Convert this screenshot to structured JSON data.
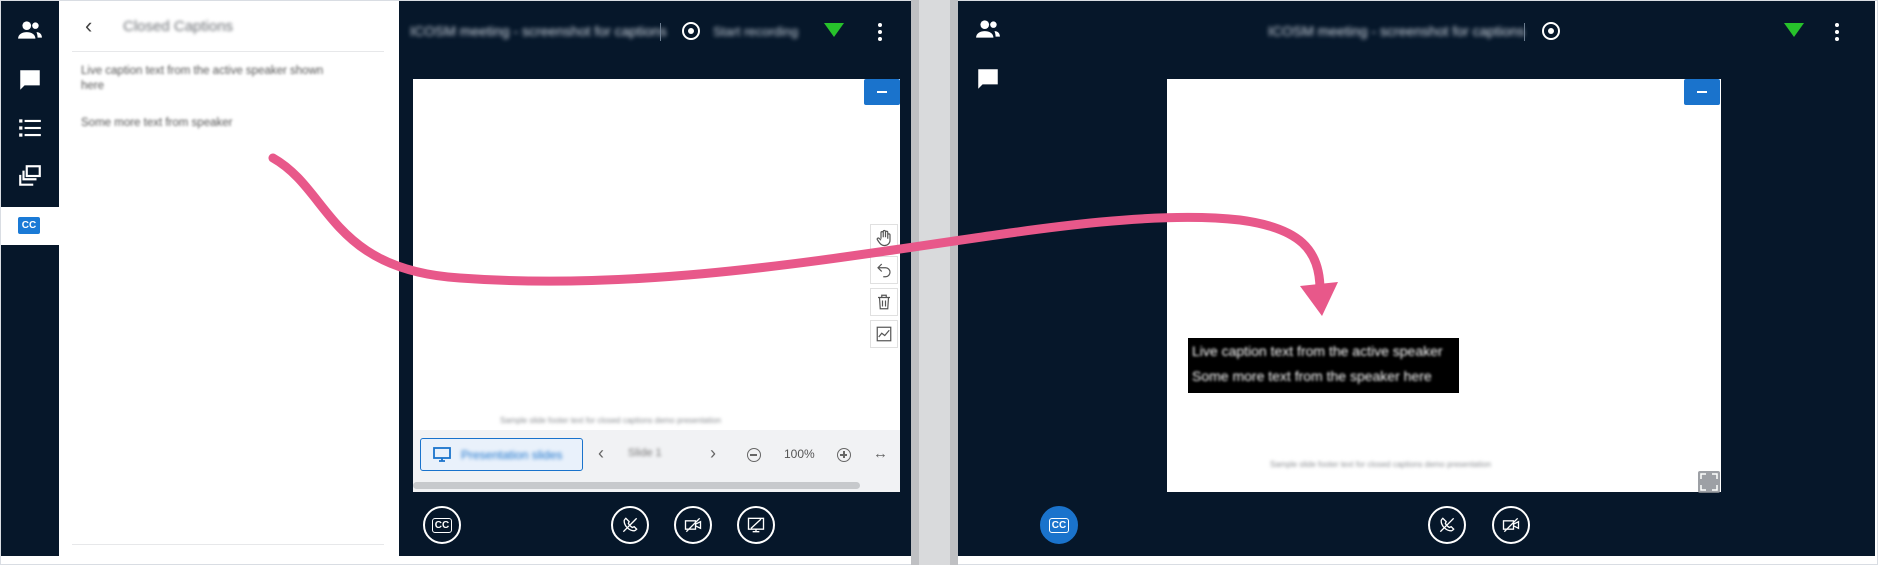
{
  "left": {
    "rail": {
      "icons": [
        "users-icon",
        "chat-icon",
        "list-icon",
        "stack-icon",
        "closed-captions-icon"
      ],
      "cc_label": "CC"
    },
    "captions_panel": {
      "title": "Closed Captions",
      "lines": [
        "Live caption text from the active speaker shown",
        "here",
        "Some more text from speaker"
      ]
    },
    "topbar": {
      "meeting_title": "ICOSM meeting - screenshot for captions",
      "record_label": "Start recording"
    },
    "footer_text": "Sample slide footer text for closed captions demo presentation",
    "presentation_bar": {
      "slide_label": "Presentation slides",
      "page_label": "Slide 1",
      "zoom": "100%"
    },
    "bottom_cc": "CC"
  },
  "right": {
    "topbar": {
      "meeting_title": "ICOSM meeting - screenshot for captions"
    },
    "caption_overlay": {
      "line1": "Live caption text from the active speaker",
      "line2": "Some more text from the speaker here"
    },
    "footer_text": "Sample slide footer text for closed captions demo presentation",
    "bottom_cc": "CC"
  },
  "colors": {
    "background": "#06172a",
    "accent": "#1a73cc",
    "arrow": "#e8588a",
    "signal": "#27c22b"
  }
}
